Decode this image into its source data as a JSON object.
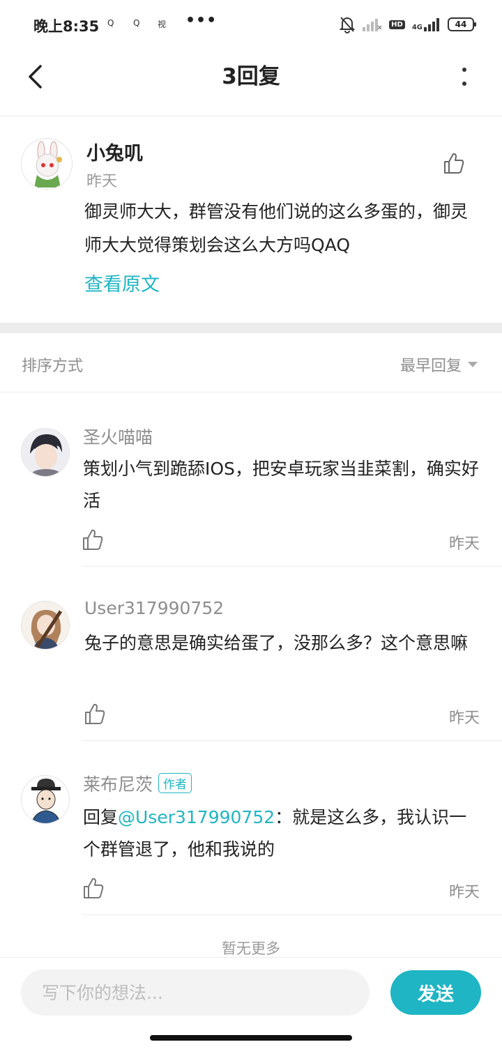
{
  "status_bar": {
    "time": "晚上8:35",
    "app_icons": [
      "Q",
      "Q",
      "视"
    ],
    "more": "•••",
    "hd": "HD",
    "network": "4G",
    "battery": "44"
  },
  "header": {
    "title": "3回复",
    "back_icon": "chevron-left-icon",
    "more_icon": "vertical-dots-icon"
  },
  "main_comment": {
    "author": "小兔叽",
    "time": "昨天",
    "text": "御灵师大大，群管没有他们说的这么多蛋的，御灵师大大觉得策划会这么大方吗QAQ",
    "view_original": "查看原文",
    "like_icon": "thumbs-up-icon"
  },
  "sort": {
    "label": "排序方式",
    "value": "最早回复"
  },
  "replies": [
    {
      "author": "圣火喵喵",
      "text": "策划小气到跪舔IOS，把安卓玩家当韭菜割，确实好活",
      "time": "昨天"
    },
    {
      "author": "User317990752",
      "text": "兔子的意思是确实给蛋了，没那么多？这个意思嘛",
      "time": "昨天"
    },
    {
      "author": "莱布尼茨",
      "tag": "作者",
      "reply_prefix": "回复",
      "mention": "@User317990752",
      "text": "：就是这么多，我认识一个群管退了，他和我说的",
      "time": "昨天"
    }
  ],
  "footer": {
    "no_more": "暂无更多",
    "input_placeholder": "写下你的想法...",
    "send_label": "发送"
  },
  "colors": {
    "accent": "#1fb5c4",
    "muted": "#8e8e8e",
    "divider": "#ececec"
  }
}
